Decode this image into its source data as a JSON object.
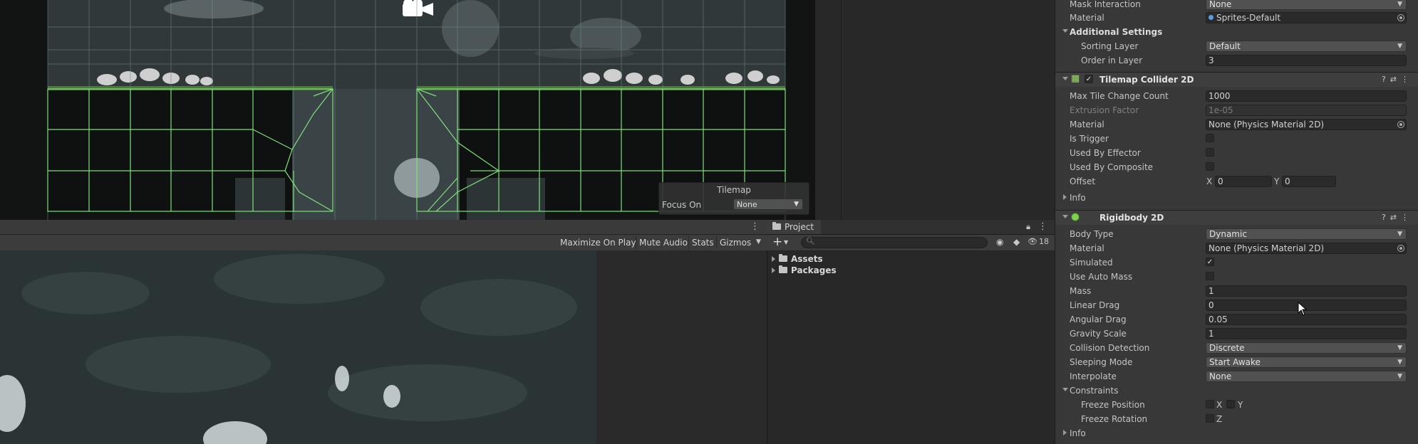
{
  "scene": {
    "overlay": {
      "title": "Tilemap",
      "focus_label": "Focus On",
      "focus_value": "None"
    }
  },
  "game": {
    "toolbar": {
      "maximize": "Maximize On Play",
      "mute": "Mute Audio",
      "stats": "Stats",
      "gizmos": "Gizmos"
    }
  },
  "project": {
    "tab": "Project",
    "search_placeholder": "",
    "hidden_count": "18",
    "items": [
      {
        "label": "Assets"
      },
      {
        "label": "Packages"
      }
    ]
  },
  "inspector": {
    "sprite_renderer": {
      "mask_interaction": {
        "label": "Mask Interaction",
        "value": "None"
      },
      "material": {
        "label": "Material",
        "value": "Sprites-Default"
      },
      "additional_settings": "Additional Settings",
      "sorting_layer": {
        "label": "Sorting Layer",
        "value": "Default"
      },
      "order_in_layer": {
        "label": "Order in Layer",
        "value": "3"
      }
    },
    "tilemap_collider": {
      "title": "Tilemap Collider 2D",
      "max_tile": {
        "label": "Max Tile Change Count",
        "value": "1000"
      },
      "extrusion": {
        "label": "Extrusion Factor",
        "value": "1e-05"
      },
      "material": {
        "label": "Material",
        "value": "None (Physics Material 2D)"
      },
      "is_trigger": {
        "label": "Is Trigger",
        "checked": false
      },
      "used_by_effector": {
        "label": "Used By Effector",
        "checked": false
      },
      "used_by_composite": {
        "label": "Used By Composite",
        "checked": false
      },
      "offset": {
        "label": "Offset",
        "x_label": "X",
        "x": "0",
        "y_label": "Y",
        "y": "0"
      },
      "info": "Info"
    },
    "rigidbody": {
      "title": "Rigidbody 2D",
      "body_type": {
        "label": "Body Type",
        "value": "Dynamic"
      },
      "material": {
        "label": "Material",
        "value": "None (Physics Material 2D)"
      },
      "simulated": {
        "label": "Simulated",
        "checked": true
      },
      "use_auto_mass": {
        "label": "Use Auto Mass",
        "checked": false
      },
      "mass": {
        "label": "Mass",
        "value": "1"
      },
      "linear_drag": {
        "label": "Linear Drag",
        "value": "0"
      },
      "angular_drag": {
        "label": "Angular Drag",
        "value": "0.05"
      },
      "gravity_scale": {
        "label": "Gravity Scale",
        "value": "1"
      },
      "collision_detection": {
        "label": "Collision Detection",
        "value": "Discrete"
      },
      "sleeping_mode": {
        "label": "Sleeping Mode",
        "value": "Start Awake"
      },
      "interpolate": {
        "label": "Interpolate",
        "value": "None"
      },
      "constraints": "Constraints",
      "freeze_position": {
        "label": "Freeze Position",
        "x": "X",
        "y": "Y"
      },
      "freeze_rotation": {
        "label": "Freeze Rotation",
        "z": "Z"
      },
      "info": "Info"
    }
  },
  "colors": {
    "collider_green": "#7ee07a",
    "panel_bg": "#383838",
    "field_bg": "#2a2a2a"
  }
}
